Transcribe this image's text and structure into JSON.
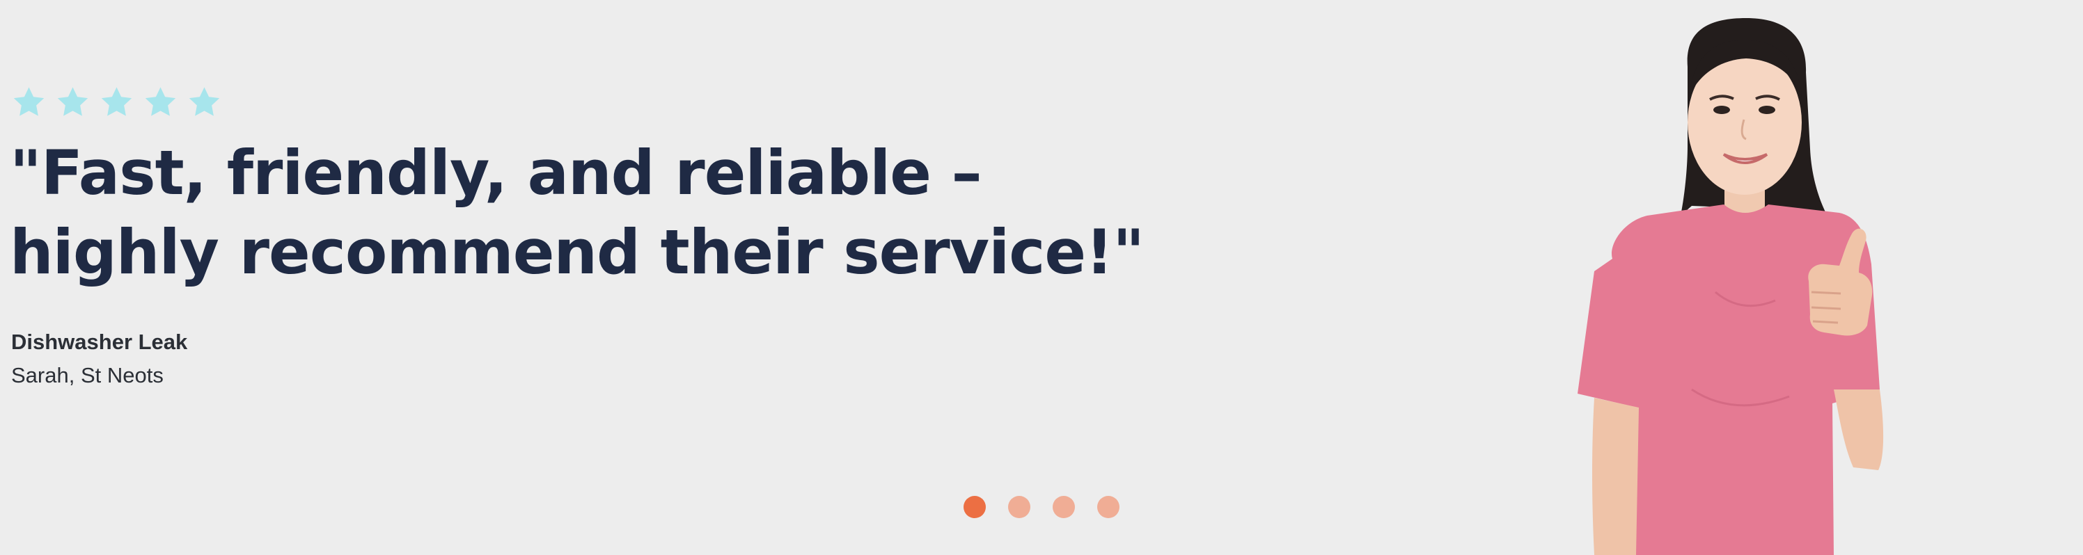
{
  "rating": {
    "stars": 5,
    "star_color": "#a7e5ec"
  },
  "quote": {
    "line1": "\"Fast, friendly, and reliable –",
    "line2": "highly recommend their service!\""
  },
  "service": "Dishwasher Leak",
  "customer": "Sarah, St Neots",
  "pagination": {
    "total": 4,
    "active_index": 0,
    "active_color": "#ec6f43",
    "inactive_color": "#f0ad95"
  },
  "image": {
    "icon": "person-thumbs-up-photo"
  },
  "colors": {
    "background": "#ededed",
    "heading": "#1f2a44",
    "body": "#2b2f36",
    "shirt": "#e57a93"
  }
}
